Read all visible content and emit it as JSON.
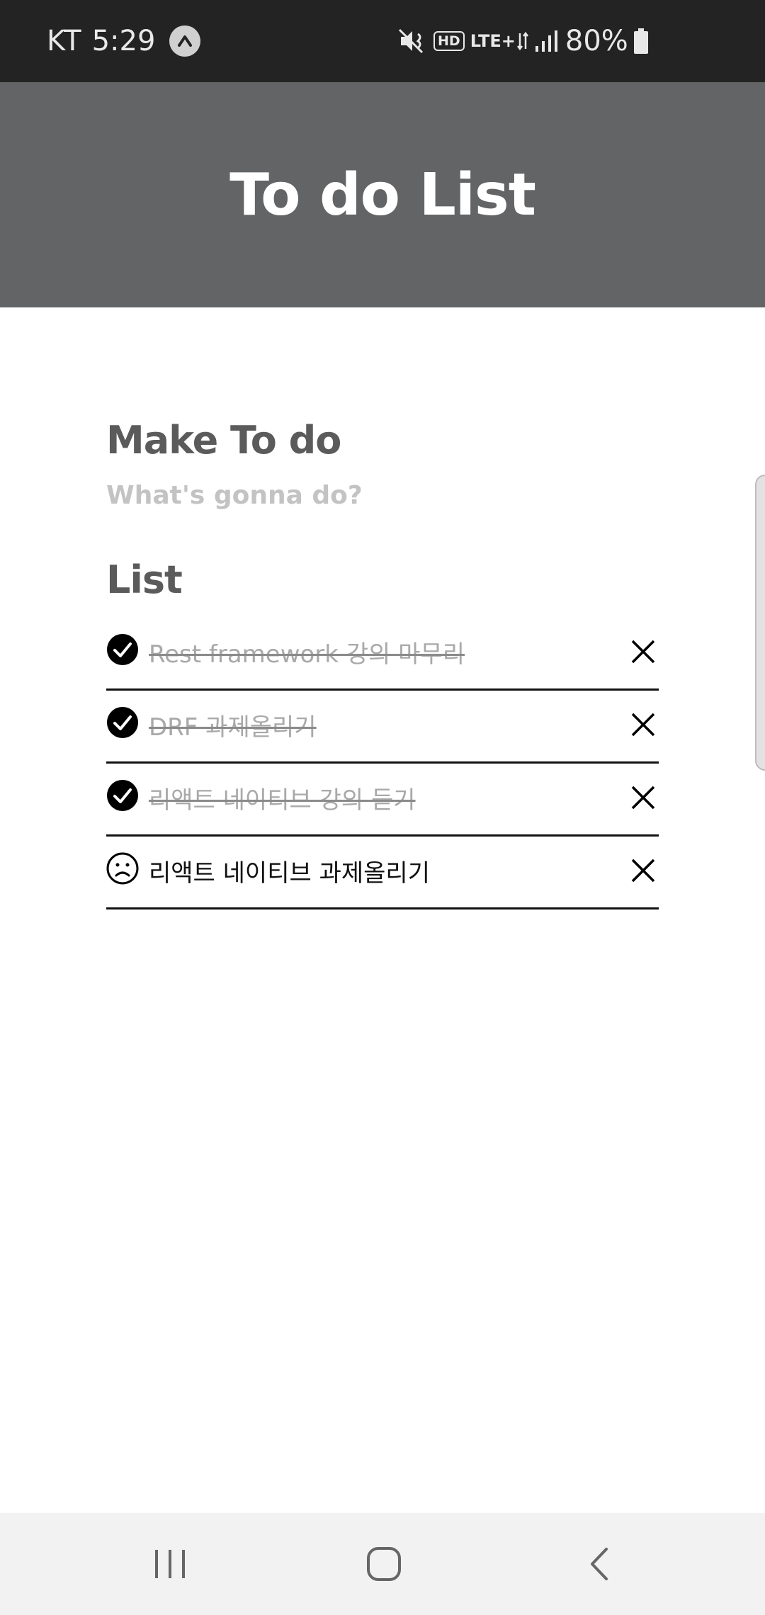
{
  "status_bar": {
    "carrier": "KT",
    "time": "5:29",
    "hd_label": "HD",
    "network_label": "LTE+",
    "battery": "80%"
  },
  "header": {
    "title": "To do List"
  },
  "make_todo": {
    "title": "Make To do",
    "placeholder": "What's gonna do?"
  },
  "list": {
    "title": "List",
    "items": [
      {
        "text": "Rest framework 강의 마무리",
        "done": true
      },
      {
        "text": "DRF 과제올리기",
        "done": true
      },
      {
        "text": "리액트 네이티브 강의 듣기",
        "done": true
      },
      {
        "text": "리액트 네이티브 과제올리기",
        "done": false
      }
    ]
  },
  "icons": {
    "done": "check-circle-icon",
    "pending": "sad-face-icon",
    "delete": "close-icon"
  },
  "colors": {
    "status_bar_bg": "#232323",
    "header_bg": "#636466",
    "header_text": "#ffffff",
    "section_title": "#5b5b5b",
    "done_text": "#a9a9a9",
    "nav_bar_bg": "#f2f2f2"
  }
}
